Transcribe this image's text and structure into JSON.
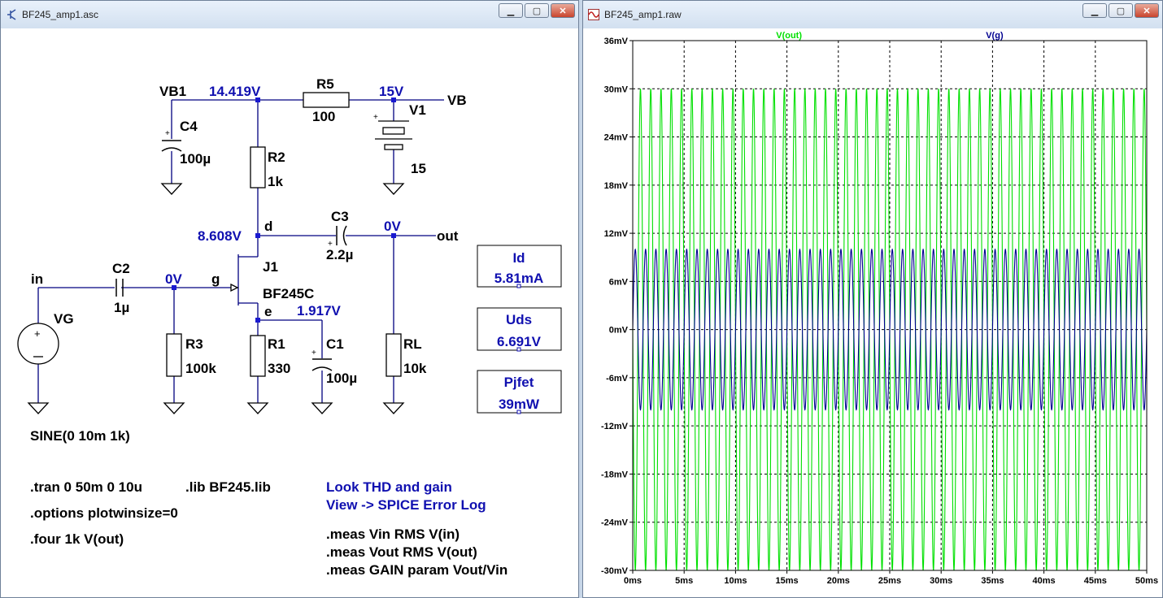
{
  "left_window": {
    "title": "BF245_amp1.asc",
    "icon": "transistor-icon",
    "controls": [
      "minimize",
      "maximize",
      "close"
    ]
  },
  "right_window": {
    "title": "BF245_amp1.raw",
    "icon": "waveform-icon",
    "controls": [
      "minimize",
      "maximize",
      "close"
    ]
  },
  "schematic": {
    "nets": {
      "vb1": "VB1",
      "vb": "VB",
      "in": "in",
      "out": "out",
      "d": "d",
      "g": "g",
      "e": "e"
    },
    "node_voltages": {
      "vb1": "14.419V",
      "vb": "15V",
      "drain": "8.608V",
      "out": "0V",
      "gate": "0V",
      "source": "1.917V"
    },
    "components": {
      "r5": {
        "name": "R5",
        "value": "100"
      },
      "v1": {
        "name": "V1",
        "value": "15"
      },
      "c4": {
        "name": "C4",
        "value": "100µ"
      },
      "r2": {
        "name": "R2",
        "value": "1k"
      },
      "c3": {
        "name": "C3",
        "value": "2.2µ"
      },
      "c2": {
        "name": "C2",
        "value": "1µ"
      },
      "j1": {
        "name": "J1",
        "value": "BF245C"
      },
      "r3": {
        "name": "R3",
        "value": "100k"
      },
      "r1": {
        "name": "R1",
        "value": "330"
      },
      "c1": {
        "name": "C1",
        "value": "100µ"
      },
      "rl": {
        "name": "RL",
        "value": "10k"
      },
      "vg": {
        "name": "VG",
        "value": "SINE(0 10m 1k)"
      }
    },
    "probes": [
      {
        "label": "Id",
        "value": "5.81mA"
      },
      {
        "label": "Uds",
        "value": "6.691V"
      },
      {
        "label": "Pjfet",
        "value": "39mW"
      }
    ],
    "directives": {
      "tran": ".tran 0 50m 0 10u",
      "lib": ".lib BF245.lib",
      "options": ".options plotwinsize=0",
      "four": ".four 1k V(out)",
      "meas1": ".meas Vin RMS V(in)",
      "meas2": ".meas Vout RMS V(out)",
      "meas3": ".meas GAIN param Vout/Vin"
    },
    "comment": {
      "line1": "Look THD and gain",
      "line2": "View -> SPICE Error Log"
    }
  },
  "colors": {
    "wire": "#000080",
    "voltage_label": "#1010b0",
    "trace_out": "#00e000",
    "trace_g": "#000090",
    "grid": "#000000"
  },
  "chart_data": {
    "type": "line",
    "title": "",
    "xlabel": "",
    "ylabel": "",
    "xlim": [
      0,
      50
    ],
    "ylim": [
      -30,
      36
    ],
    "x_ticks": [
      "0ms",
      "5ms",
      "10ms",
      "15ms",
      "20ms",
      "25ms",
      "30ms",
      "35ms",
      "40ms",
      "45ms",
      "50ms"
    ],
    "y_ticks": [
      "36mV",
      "30mV",
      "24mV",
      "18mV",
      "12mV",
      "6mV",
      "0mV",
      "-6mV",
      "-12mV",
      "-18mV",
      "-24mV",
      "-30mV"
    ],
    "grid": true,
    "series": [
      {
        "name": "V(out)",
        "color": "#00e000",
        "waveform": "sine",
        "frequency_khz": 1,
        "amplitude_mv": 30,
        "offset_mv": 0,
        "phase": "inverted"
      },
      {
        "name": "V(g)",
        "color": "#000090",
        "waveform": "sine",
        "frequency_khz": 1,
        "amplitude_mv": 10,
        "offset_mv": 0,
        "phase": "normal"
      }
    ]
  }
}
